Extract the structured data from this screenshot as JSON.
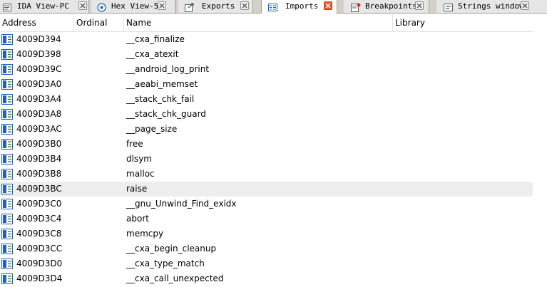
{
  "tabs": [
    {
      "label": "IDA View-PC",
      "icon": "ida-view-icon",
      "active": false
    },
    {
      "label": "Hex View-5",
      "icon": "hex-view-icon",
      "active": false
    },
    {
      "label": "Exports",
      "icon": "exports-icon",
      "active": false
    },
    {
      "label": "Imports",
      "icon": "imports-icon",
      "active": true
    },
    {
      "label": "Breakpoints",
      "icon": "breakpoints-icon",
      "active": false
    },
    {
      "label": "Strings window",
      "icon": "strings-icon",
      "active": false
    }
  ],
  "columns": {
    "address": "Address",
    "ordinal": "Ordinal",
    "name": "Name",
    "library": "Library"
  },
  "rows": [
    {
      "address": "4009D394",
      "ordinal": "",
      "name": "__cxa_finalize",
      "library": ""
    },
    {
      "address": "4009D398",
      "ordinal": "",
      "name": "__cxa_atexit",
      "library": ""
    },
    {
      "address": "4009D39C",
      "ordinal": "",
      "name": "__android_log_print",
      "library": ""
    },
    {
      "address": "4009D3A0",
      "ordinal": "",
      "name": "__aeabi_memset",
      "library": ""
    },
    {
      "address": "4009D3A4",
      "ordinal": "",
      "name": "__stack_chk_fail",
      "library": ""
    },
    {
      "address": "4009D3A8",
      "ordinal": "",
      "name": "__stack_chk_guard",
      "library": ""
    },
    {
      "address": "4009D3AC",
      "ordinal": "",
      "name": "__page_size",
      "library": ""
    },
    {
      "address": "4009D3B0",
      "ordinal": "",
      "name": "free",
      "library": ""
    },
    {
      "address": "4009D3B4",
      "ordinal": "",
      "name": "dlsym",
      "library": ""
    },
    {
      "address": "4009D3B8",
      "ordinal": "",
      "name": "malloc",
      "library": ""
    },
    {
      "address": "4009D3BC",
      "ordinal": "",
      "name": "raise",
      "library": "",
      "selected": true
    },
    {
      "address": "4009D3C0",
      "ordinal": "",
      "name": "__gnu_Unwind_Find_exidx",
      "library": ""
    },
    {
      "address": "4009D3C4",
      "ordinal": "",
      "name": "abort",
      "library": ""
    },
    {
      "address": "4009D3C8",
      "ordinal": "",
      "name": "memcpy",
      "library": ""
    },
    {
      "address": "4009D3CC",
      "ordinal": "",
      "name": "__cxa_begin_cleanup",
      "library": ""
    },
    {
      "address": "4009D3D0",
      "ordinal": "",
      "name": "__cxa_type_match",
      "library": ""
    },
    {
      "address": "4009D3D4",
      "ordinal": "",
      "name": "__cxa_call_unexpected",
      "library": ""
    }
  ],
  "colors": {
    "active_close": "#e05a2b",
    "selected_row": "#eeeeee",
    "icon_blue": "#1f5fbf"
  }
}
